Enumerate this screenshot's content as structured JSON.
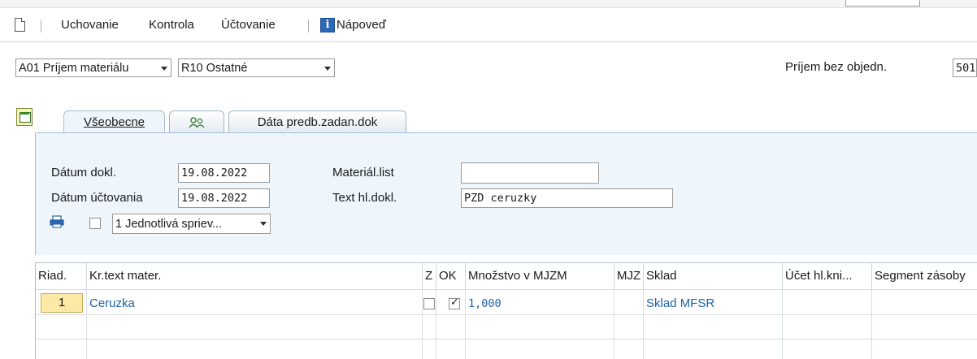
{
  "toolbar": {
    "items": [
      "Uchovanie",
      "Kontrola",
      "Účtovanie"
    ],
    "help_label": "Nápoveď",
    "info_glyph": "i"
  },
  "header": {
    "transaction_dd": "A01 Príjem materiálu",
    "reference_dd": "R10 Ostatné",
    "movement_label": "Príjem bez objedn.",
    "movement_type": "501"
  },
  "tabs": [
    {
      "label": "Všeobecne",
      "active": true
    },
    {
      "label": "",
      "icon": "partners-icon"
    },
    {
      "label": "Dáta predb.zadan.dok"
    }
  ],
  "general": {
    "doc_date_label": "Dátum dokl.",
    "doc_date": "19.08.2022",
    "post_date_label": "Dátum účtovania",
    "post_date": "19.08.2022",
    "material_slip_label": "Materiál.list",
    "material_slip": "",
    "header_text_label": "Text hl.dokl.",
    "header_text": "PZD ceruzky",
    "print_option": "1 Jednotlivá spriev..."
  },
  "table": {
    "columns": [
      "Riad.",
      "Kr.text mater.",
      "Z",
      "OK",
      "Množstvo v MJZM",
      "MJZ",
      "Sklad",
      "Účet hl.kni...",
      "Segment zásoby"
    ],
    "rows": [
      {
        "line": "1",
        "material": "Ceruzka",
        "z": false,
        "ok": true,
        "qty": "1,000",
        "uom": "",
        "storage": "Sklad MFSR",
        "gl": "",
        "segment": ""
      }
    ]
  },
  "colors": {
    "accent_blue": "#1d63a8",
    "panel_bg": "#eef5fb",
    "row_button": "#fbe9a5"
  }
}
